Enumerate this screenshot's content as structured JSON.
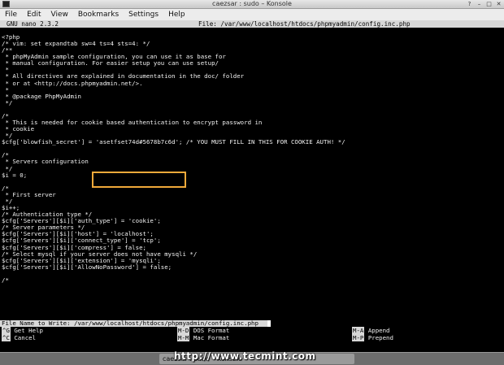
{
  "window": {
    "title": "caezsar : sudo – Konsole",
    "buttons": [
      "?",
      "–",
      "□",
      "✕"
    ]
  },
  "menu": [
    "File",
    "Edit",
    "View",
    "Bookmarks",
    "Settings",
    "Help"
  ],
  "nano": {
    "version": "GNU nano 2.3.2",
    "file_header": "File: /var/www/localhost/htdocs/phpmyadmin/config.inc.php"
  },
  "editor_lines": [
    "<?php",
    "/* vim: set expandtab sw=4 ts=4 sts=4: */",
    "/**",
    " * phpMyAdmin sample configuration, you can use it as base for",
    " * manual configuration. For easier setup you can use setup/",
    " *",
    " * All directives are explained in documentation in the doc/ folder",
    " * or at <http://docs.phpmyadmin.net/>.",
    " *",
    " * @package PhpMyAdmin",
    " */",
    "",
    "/*",
    " * This is needed for cookie based authentication to encrypt password in",
    " * cookie",
    " */",
    "$cfg['blowfish_secret'] = 'asetfset74d#5678b7c6d'; /* YOU MUST FILL IN THIS FOR COOKIE AUTH! */",
    "",
    "/*",
    " * Servers configuration",
    " */",
    "$i = 0;",
    "",
    "/*",
    " * First server",
    " */",
    "$i++;",
    "/* Authentication type */",
    "$cfg['Servers'][$i]['auth_type'] = 'cookie';",
    "/* Server parameters */",
    "$cfg['Servers'][$i]['host'] = 'localhost';",
    "$cfg['Servers'][$i]['connect_type'] = 'tcp';",
    "$cfg['Servers'][$i]['compress'] = false;",
    "/* Select mysql if your server does not have mysqli */",
    "$cfg['Servers'][$i]['extension'] = 'mysqli';",
    "$cfg['Servers'][$i]['AllowNoPassword'] = false;",
    "",
    "/*"
  ],
  "prompt": "File Name to Write: /var/www/localhost/htdocs/phpmyadmin/config.inc.php",
  "shortcuts": [
    {
      "key": "^G",
      "label": "Get Help"
    },
    {
      "key": "^C",
      "label": "Cancel"
    },
    {
      "key": "M-D",
      "label": "DOS Format"
    },
    {
      "key": "M-M",
      "label": "Mac Format"
    },
    {
      "key": "M-A",
      "label": "Append"
    },
    {
      "key": "M-P",
      "label": "Prepend"
    }
  ],
  "taskbar": {
    "item": "caezsar : sudo – Konsole"
  },
  "watermark": "http://www.tecmint.com",
  "colors": {
    "highlight_border": "#f0a93a",
    "nano_bar": "#d8d8d8",
    "terminal_bg": "#000000"
  }
}
